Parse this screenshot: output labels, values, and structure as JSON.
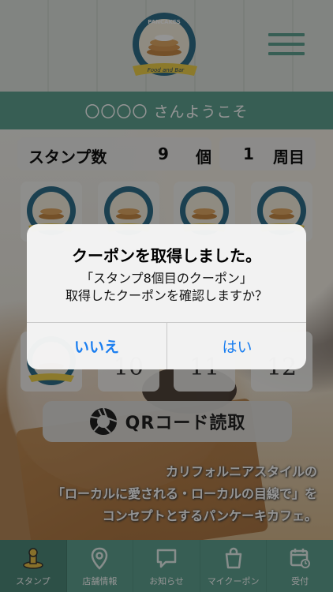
{
  "header": {
    "logo_text_top": "PANCAKES",
    "logo_text_bottom": "Food and Bar",
    "welcome": "〇〇〇〇 さんようこそ"
  },
  "stamp_status": {
    "label": "スタンプ数",
    "count": "9",
    "count_unit": "個",
    "round": "1",
    "round_unit": "周目"
  },
  "stamp_grid": {
    "visible_numbers": [
      "10",
      "11",
      "12"
    ]
  },
  "qr_button": {
    "label": "QRコード読取"
  },
  "tagline": {
    "line1": "カリフォルニアスタイルの",
    "line2": "「ローカルに愛される・ローカルの目線で」を",
    "line3": "コンセプトとするパンケーキカフェ。"
  },
  "alert": {
    "title": "クーポンを取得しました。",
    "message_line1": "「スタンプ8個目のクーポン」",
    "message_line2": "取得したクーポンを確認しますか？",
    "button_no": "いいえ",
    "button_yes": "はい"
  },
  "tabs": [
    {
      "label": "スタンプ",
      "icon": "stamp-icon",
      "active": true
    },
    {
      "label": "店舗情報",
      "icon": "location-pin-icon",
      "active": false
    },
    {
      "label": "お知らせ",
      "icon": "speech-bubble-icon",
      "active": false
    },
    {
      "label": "マイクーポン",
      "icon": "shopping-bag-icon",
      "active": false
    },
    {
      "label": "受付",
      "icon": "calendar-icon",
      "active": false
    }
  ],
  "colors": {
    "accent": "#5fa392",
    "alert_button": "#1a7ef0"
  }
}
